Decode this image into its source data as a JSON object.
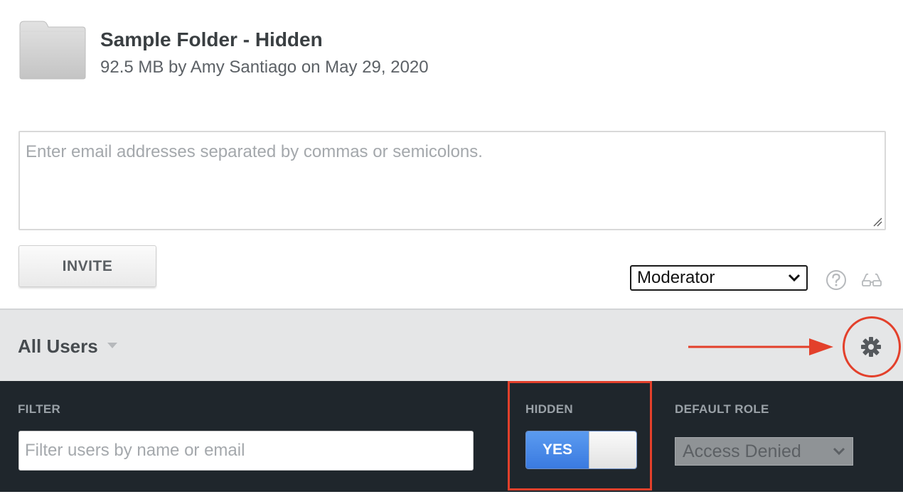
{
  "folder": {
    "title": "Sample Folder - Hidden",
    "meta": "92.5 MB by Amy Santiago on May 29, 2020",
    "icon": "folder-icon"
  },
  "invite": {
    "email_placeholder": "Enter email addresses separated by commas or semicolons.",
    "button_label": "INVITE",
    "role_value": "Moderator",
    "help_icon": "question-circle-icon",
    "preview_icon": "glasses-icon"
  },
  "users_bar": {
    "label": "All Users",
    "settings_icon": "gear-icon"
  },
  "settings_panel": {
    "filter_label": "FILTER",
    "filter_placeholder": "Filter users by name or email",
    "hidden_label": "HIDDEN",
    "hidden_toggle_value": "YES",
    "default_role_label": "DEFAULT ROLE",
    "default_role_value": "Access Denied"
  },
  "colors": {
    "annotation_red": "#e3402b",
    "dark_panel": "#1f262c",
    "toggle_blue": "#3a7ae0",
    "bar_gray": "#e5e6e7"
  }
}
